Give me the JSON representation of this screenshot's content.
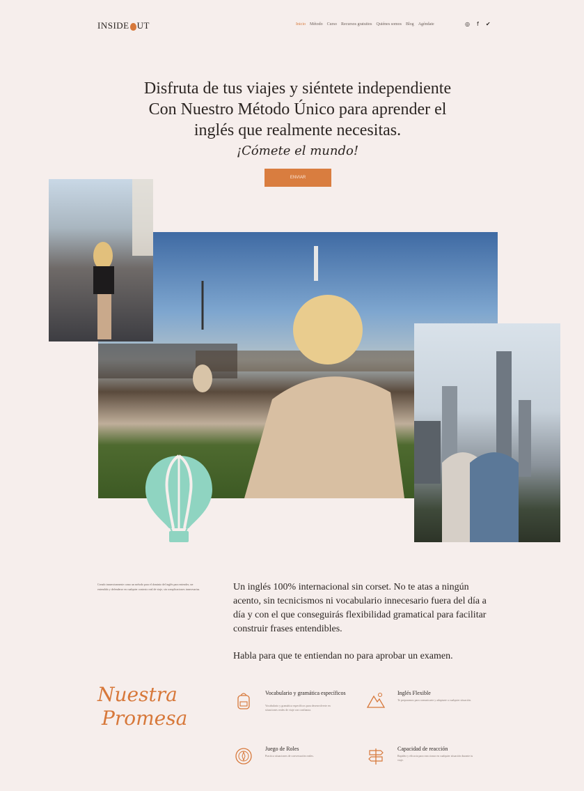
{
  "brand": {
    "logo_left": "INSIDE",
    "logo_right": "UT"
  },
  "nav": {
    "items": [
      "Inicio",
      "Método",
      "Curso",
      "Recursos gratuitos",
      "Quiénes somos",
      "Blog",
      "Agéndate"
    ]
  },
  "social": {
    "icons": [
      "instagram-icon",
      "facebook-icon",
      "twitter-icon"
    ],
    "glyphs": [
      "◎",
      "f",
      "✔"
    ]
  },
  "hero": {
    "line1": "Disfruta de tus viajes y siéntete independiente",
    "line2": "Con Nuestro Método Único para aprender el",
    "line3": "inglés que realmente necesitas.",
    "tagline": "¡Cómete el mundo!",
    "cta_label": "ENVIAR"
  },
  "intro": {
    "small_text": "Creado inmersivamente como un método para el dominio del inglés para entender, ser entendido y defenderse en cualquier contexto real de viaje, sin complicaciones innecesarias.",
    "paragraph1": "Un inglés 100% internacional sin corset. No te atas a ningún acento, sin tecnicismos ni vocabulario innecesario fuera del día a día y con el que conseguirás flexibilidad gramatical para facilitar construir frases entendibles.",
    "paragraph2": "Habla para que te entiendan no para aprobar un examen."
  },
  "promise": {
    "title_line1": "Nuestra",
    "title_line2": "Promesa",
    "features": [
      {
        "title": "Vocabulario y gramática específicos",
        "desc": "Vocabulario y gramática específicos para desenvolverte en situaciones reales de viaje con confianza."
      },
      {
        "title": "Inglés Flexible",
        "desc": "Te preparamos para comunicarte y adaptarte a cualquier situación."
      },
      {
        "title": "Juego de Roles",
        "desc": "Practica situaciones de conversación reales."
      },
      {
        "title": "Capacidad de reacción",
        "desc": "Rapidez y eficacia para reaccionar en cualquier situación durante tu viaje."
      }
    ]
  },
  "colors": {
    "accent": "#d7783a",
    "background": "#f6eeec",
    "text": "#2b2522",
    "balloon": "#8fd4c1"
  }
}
